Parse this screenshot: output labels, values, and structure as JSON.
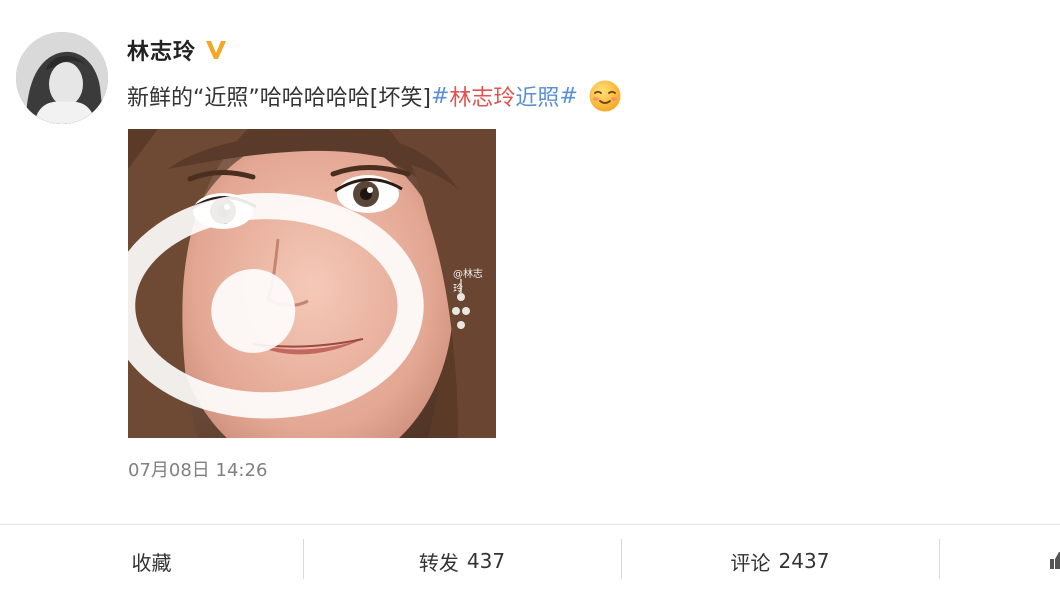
{
  "user": {
    "name": "林志玲",
    "verified_icon": "verified-v-badge-icon",
    "verified_color": "#f5a623"
  },
  "post": {
    "text_prefix": "新鲜的“近照”哈哈哈哈哈[坏笑]",
    "hashtag_open": "#",
    "hashtag_name": "林志玲",
    "hashtag_tail": "近照",
    "hashtag_close": "#",
    "emoji": "smirk-emoji-icon",
    "photo_watermark": "@林志玲",
    "timestamp": "07月08日 14:26"
  },
  "actions": {
    "favorite_label": "收藏",
    "repost_label": "转发",
    "repost_count": "437",
    "comment_label": "评论",
    "comment_count": "2437",
    "like_icon": "thumbs-up-icon"
  },
  "colors": {
    "hashtag_blue": "#5a8fd6",
    "hashtag_red": "#e0534f",
    "timestamp_gray": "#808080",
    "divider": "#d9d9d9"
  }
}
